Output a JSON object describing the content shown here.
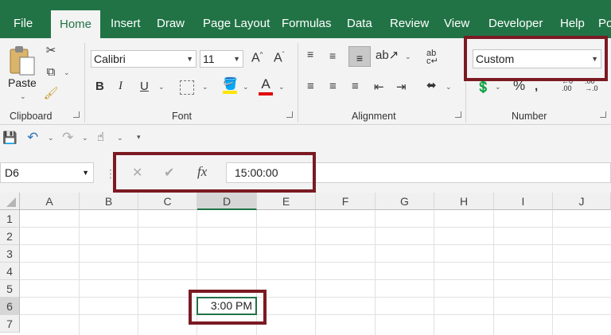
{
  "tabs": [
    "File",
    "Home",
    "Insert",
    "Draw",
    "Page Layout",
    "Formulas",
    "Data",
    "Review",
    "View",
    "Developer",
    "Help",
    "Po"
  ],
  "active_tab": "Home",
  "clipboard": {
    "paste_label": "Paste",
    "group_label": "Clipboard"
  },
  "font": {
    "name": "Calibri",
    "size": "11",
    "group_label": "Font",
    "bold": "B",
    "italic": "I",
    "underline": "U",
    "grow": "A",
    "shrink": "A",
    "font_color_glyph": "A"
  },
  "alignment": {
    "group_label": "Alignment",
    "wrap_glyph": "ab\nc"
  },
  "number": {
    "format": "Custom",
    "group_label": "Number",
    "percent": "%"
  },
  "formula_bar": {
    "name_box": "D6",
    "formula": "15:00:00",
    "cancel": "✕",
    "enter": "✔",
    "fx": "fx"
  },
  "columns": [
    "A",
    "B",
    "C",
    "D",
    "E",
    "F",
    "G",
    "H",
    "I",
    "J"
  ],
  "rows": [
    "1",
    "2",
    "3",
    "4",
    "5",
    "6",
    "7"
  ],
  "cell_d6": "3:00 PM",
  "colors": {
    "brand": "#217346",
    "highlight": "#7b1a22"
  }
}
